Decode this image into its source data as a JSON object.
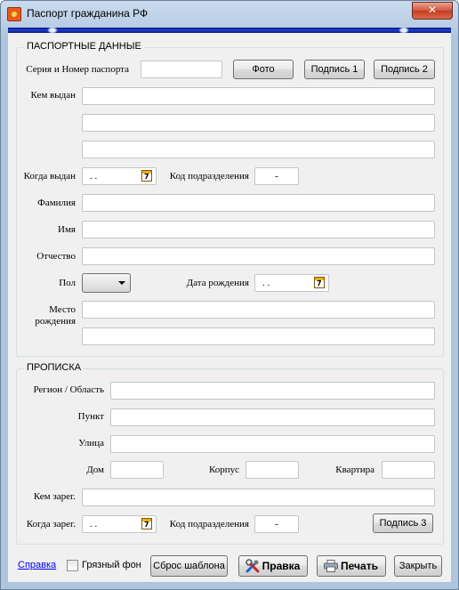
{
  "window": {
    "title": "Паспорт гражданина РФ",
    "close_glyph": "✕"
  },
  "passport": {
    "legend": "ПАСПОРТНЫЕ ДАННЫЕ",
    "series_number_label": "Серия и Номер паспорта",
    "series_number_value": "",
    "photo_button": "Фото",
    "signature1_button": "Подпись 1",
    "signature2_button": "Подпись 2",
    "issued_by_label": "Кем выдан",
    "issued_by_line1": "",
    "issued_by_line2": "",
    "issued_by_line3": "",
    "issue_date_label": "Когда выдан",
    "issue_date_value": ".  .",
    "dept_code_label": "Код подразделения",
    "dept_code_value": "-",
    "surname_label": "Фамилия",
    "surname_value": "",
    "name_label": "Имя",
    "name_value": "",
    "patronymic_label": "Отчество",
    "patronymic_value": "",
    "sex_label": "Пол",
    "sex_value": "",
    "birth_date_label": "Дата рождения",
    "birth_date_value": ".  .",
    "birthplace_label_1": "Место",
    "birthplace_label_2": "рождения",
    "birthplace_line1": "",
    "birthplace_line2": ""
  },
  "registration": {
    "legend": "ПРОПИСКА",
    "region_label": "Регион / Область",
    "region_value": "",
    "locality_label": "Пункт",
    "locality_value": "",
    "street_label": "Улица",
    "street_value": "",
    "house_label": "Дом",
    "house_value": "",
    "building_label": "Корпус",
    "building_value": "",
    "apartment_label": "Квартира",
    "apartment_value": "",
    "registered_by_label": "Кем зарег.",
    "registered_by_value": "",
    "registered_date_label": "Когда зарег.",
    "registered_date_value": ".  .",
    "dept_code_label": "Код подразделения",
    "dept_code_value": "-",
    "signature3_button": "Подпись 3"
  },
  "footer": {
    "help_link": "Справка",
    "dirty_bg_label": "Грязный фон",
    "dirty_bg_checked": false,
    "reset_template_button": "Сброс шаблона",
    "edit_button": "Правка",
    "print_button": "Печать",
    "close_button": "Закрыть"
  },
  "colors": {
    "accent_bar": "#1d3ed3",
    "link": "#0000ee",
    "close_button": "#c43a22"
  },
  "icons": {
    "app": "passport-app-icon",
    "calendar": "calendar-icon",
    "edit": "tools-icon",
    "print": "printer-icon"
  }
}
